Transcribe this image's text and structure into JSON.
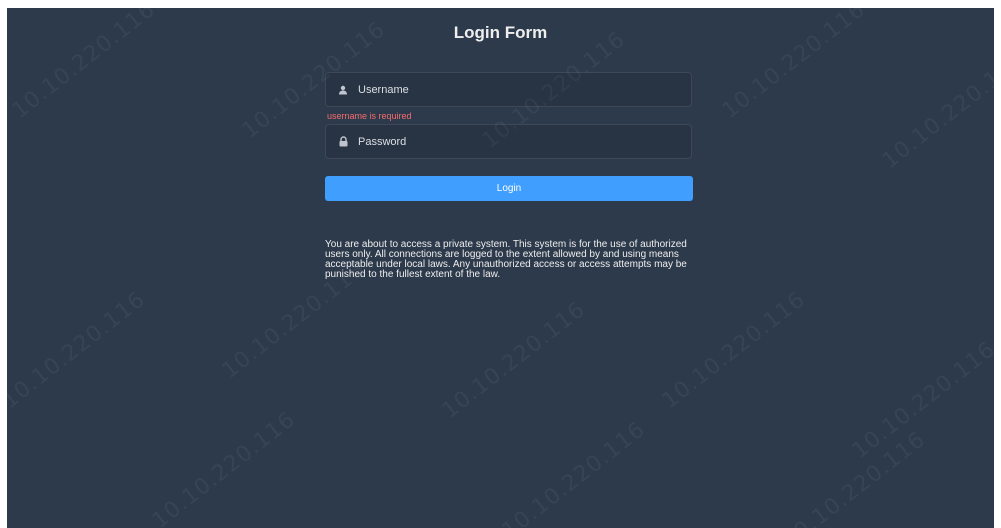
{
  "form": {
    "title": "Login Form",
    "username_placeholder": "Username",
    "username_error": "username is required",
    "password_placeholder": "Password",
    "login_label": "Login"
  },
  "notice": {
    "text": "You are about to access a private system. This system is for the use of authorized users only. All connections are logged to the extent allowed by and using means acceptable under local laws. Any unauthorized access or access attempts may be punished to the fullest extent of the law."
  },
  "watermark": {
    "text": "10.10.220.116"
  },
  "icons": {
    "username": "user-icon",
    "password": "lock-icon"
  },
  "colors": {
    "background": "#2d3a4b",
    "accent": "#409eff",
    "error": "#f56c6c",
    "text": "#eeeeee"
  }
}
